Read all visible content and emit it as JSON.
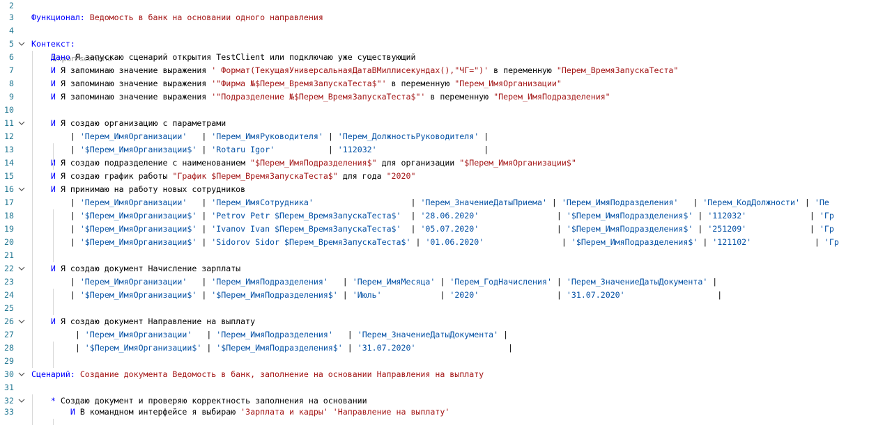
{
  "codelens": "Export scenario",
  "lines": [
    {
      "n": "2",
      "fold": false,
      "segs": []
    },
    {
      "n": "3",
      "fold": false,
      "segs": [
        {
          "c": "kw",
          "t": "Функционал: "
        },
        {
          "c": "s",
          "t": "Ведомость в банк на основании одного направления"
        }
      ]
    },
    {
      "n": "4",
      "fold": false,
      "segs": []
    },
    {
      "n": "5",
      "fold": true,
      "segs": [
        {
          "c": "kw",
          "t": "Контекст:"
        }
      ]
    },
    {
      "n": "6",
      "fold": false,
      "segs": [
        {
          "c": "t",
          "t": "    "
        },
        {
          "c": "kw",
          "t": "Дано "
        },
        {
          "c": "t",
          "t": "Я запускаю сценарий открытия TestClient или подключаю уже существующий"
        }
      ]
    },
    {
      "n": "7",
      "fold": false,
      "segs": [
        {
          "c": "t",
          "t": "    "
        },
        {
          "c": "kw",
          "t": "И "
        },
        {
          "c": "t",
          "t": "Я запоминаю значение выражения "
        },
        {
          "c": "s",
          "t": "' Формат(ТекущаяУниверсальнаяДатаВМиллисекундах(),\"ЧГ=\")'"
        },
        {
          "c": "t",
          "t": " в переменную "
        },
        {
          "c": "s",
          "t": "\"Перем_ВремяЗапускаТеста\""
        }
      ]
    },
    {
      "n": "8",
      "fold": false,
      "segs": [
        {
          "c": "t",
          "t": "    "
        },
        {
          "c": "kw",
          "t": "И "
        },
        {
          "c": "t",
          "t": "Я запоминаю значение выражения "
        },
        {
          "c": "s",
          "t": "'\"Фирма №$Перем_ВремяЗапускаТеста$\"'"
        },
        {
          "c": "t",
          "t": " в переменную "
        },
        {
          "c": "s",
          "t": "\"Перем_ИмяОрганизации\""
        }
      ]
    },
    {
      "n": "9",
      "fold": false,
      "segs": [
        {
          "c": "t",
          "t": "    "
        },
        {
          "c": "kw",
          "t": "И "
        },
        {
          "c": "t",
          "t": "Я запоминаю значение выражения "
        },
        {
          "c": "s",
          "t": "'\"Подразделение №$Перем_ВремяЗапускаТеста$\"'"
        },
        {
          "c": "t",
          "t": " в переменную "
        },
        {
          "c": "s",
          "t": "\"Перем_ИмяПодразделения\""
        }
      ]
    },
    {
      "n": "10",
      "fold": false,
      "segs": []
    },
    {
      "n": "11",
      "fold": true,
      "segs": [
        {
          "c": "t",
          "t": "    "
        },
        {
          "c": "kw",
          "t": "И "
        },
        {
          "c": "t",
          "t": "Я создаю организацию с параметрами"
        }
      ]
    },
    {
      "n": "12",
      "fold": false,
      "segs": [
        {
          "c": "t",
          "t": "        "
        },
        {
          "c": "p",
          "t": "| "
        },
        {
          "c": "tb",
          "t": "'Перем_ИмяОрганизации'   "
        },
        {
          "c": "p",
          "t": "| "
        },
        {
          "c": "tb",
          "t": "'Перем_ИмяРуководителя' "
        },
        {
          "c": "p",
          "t": "| "
        },
        {
          "c": "tb",
          "t": "'Перем_ДолжностьРуководителя' "
        },
        {
          "c": "p",
          "t": "|"
        }
      ]
    },
    {
      "n": "13",
      "fold": false,
      "segs": [
        {
          "c": "t",
          "t": "        "
        },
        {
          "c": "p",
          "t": "| "
        },
        {
          "c": "tb",
          "t": "'$Перем_ИмяОрганизации$' "
        },
        {
          "c": "p",
          "t": "| "
        },
        {
          "c": "tb",
          "t": "'Rotaru Igor'           "
        },
        {
          "c": "p",
          "t": "| "
        },
        {
          "c": "tb",
          "t": "'112032'                      "
        },
        {
          "c": "p",
          "t": "|"
        }
      ]
    },
    {
      "n": "14",
      "fold": false,
      "segs": [
        {
          "c": "t",
          "t": "    "
        },
        {
          "c": "kw",
          "t": "И "
        },
        {
          "c": "t",
          "t": "Я создаю подразделение с наименованием "
        },
        {
          "c": "s",
          "t": "\"$Перем_ИмяПодразделения$\""
        },
        {
          "c": "t",
          "t": " для организации "
        },
        {
          "c": "s",
          "t": "\"$Перем_ИмяОрганизации$\""
        }
      ]
    },
    {
      "n": "15",
      "fold": false,
      "segs": [
        {
          "c": "t",
          "t": "    "
        },
        {
          "c": "kw",
          "t": "И "
        },
        {
          "c": "t",
          "t": "Я создаю график работы "
        },
        {
          "c": "s",
          "t": "\"График $Перем_ВремяЗапускаТеста$\""
        },
        {
          "c": "t",
          "t": " для года "
        },
        {
          "c": "s",
          "t": "\"2020\""
        }
      ]
    },
    {
      "n": "16",
      "fold": true,
      "segs": [
        {
          "c": "t",
          "t": "    "
        },
        {
          "c": "kw",
          "t": "И "
        },
        {
          "c": "t",
          "t": "Я принимаю на работу новых сотрудников"
        }
      ]
    },
    {
      "n": "17",
      "fold": false,
      "segs": [
        {
          "c": "t",
          "t": "        "
        },
        {
          "c": "p",
          "t": "| "
        },
        {
          "c": "tb",
          "t": "'Перем_ИмяОрганизации'   "
        },
        {
          "c": "p",
          "t": "| "
        },
        {
          "c": "tb",
          "t": "'Перем_ИмяСотрудника'                    "
        },
        {
          "c": "p",
          "t": "| "
        },
        {
          "c": "tb",
          "t": "'Перем_ЗначениеДатыПриема' "
        },
        {
          "c": "p",
          "t": "| "
        },
        {
          "c": "tb",
          "t": "'Перем_ИмяПодразделения'   "
        },
        {
          "c": "p",
          "t": "| "
        },
        {
          "c": "tb",
          "t": "'Перем_КодДолжности' "
        },
        {
          "c": "p",
          "t": "| "
        },
        {
          "c": "tb",
          "t": "'Пе"
        }
      ]
    },
    {
      "n": "18",
      "fold": false,
      "segs": [
        {
          "c": "t",
          "t": "        "
        },
        {
          "c": "p",
          "t": "| "
        },
        {
          "c": "tb",
          "t": "'$Перем_ИмяОрганизации$' "
        },
        {
          "c": "p",
          "t": "| "
        },
        {
          "c": "tb",
          "t": "'Petrov Petr $Перем_ВремяЗапускаТеста$'  "
        },
        {
          "c": "p",
          "t": "| "
        },
        {
          "c": "tb",
          "t": "'28.06.2020'                "
        },
        {
          "c": "p",
          "t": "| "
        },
        {
          "c": "tb",
          "t": "'$Перем_ИмяПодразделения$' "
        },
        {
          "c": "p",
          "t": "| "
        },
        {
          "c": "tb",
          "t": "'112032'             "
        },
        {
          "c": "p",
          "t": "| "
        },
        {
          "c": "tb",
          "t": "'Гр"
        }
      ]
    },
    {
      "n": "19",
      "fold": false,
      "segs": [
        {
          "c": "t",
          "t": "        "
        },
        {
          "c": "p",
          "t": "| "
        },
        {
          "c": "tb",
          "t": "'$Перем_ИмяОрганизации$' "
        },
        {
          "c": "p",
          "t": "| "
        },
        {
          "c": "tb",
          "t": "'Ivanov Ivan $Перем_ВремяЗапускаТеста$'  "
        },
        {
          "c": "p",
          "t": "| "
        },
        {
          "c": "tb",
          "t": "'05.07.2020'                "
        },
        {
          "c": "p",
          "t": "| "
        },
        {
          "c": "tb",
          "t": "'$Перем_ИмяПодразделения$' "
        },
        {
          "c": "p",
          "t": "| "
        },
        {
          "c": "tb",
          "t": "'251209'             "
        },
        {
          "c": "p",
          "t": "| "
        },
        {
          "c": "tb",
          "t": "'Гр"
        }
      ]
    },
    {
      "n": "20",
      "fold": false,
      "segs": [
        {
          "c": "t",
          "t": "        "
        },
        {
          "c": "p",
          "t": "| "
        },
        {
          "c": "tb",
          "t": "'$Перем_ИмяОрганизации$' "
        },
        {
          "c": "p",
          "t": "| "
        },
        {
          "c": "tb",
          "t": "'Sidorov Sidor $Перем_ВремяЗапускаТеста$' "
        },
        {
          "c": "p",
          "t": "| "
        },
        {
          "c": "tb",
          "t": "'01.06.2020'                "
        },
        {
          "c": "p",
          "t": "| "
        },
        {
          "c": "tb",
          "t": "'$Перем_ИмяПодразделения$' "
        },
        {
          "c": "p",
          "t": "| "
        },
        {
          "c": "tb",
          "t": "'121102'             "
        },
        {
          "c": "p",
          "t": "| "
        },
        {
          "c": "tb",
          "t": "'Гр"
        }
      ]
    },
    {
      "n": "21",
      "fold": false,
      "segs": []
    },
    {
      "n": "22",
      "fold": true,
      "segs": [
        {
          "c": "t",
          "t": "    "
        },
        {
          "c": "kw",
          "t": "И "
        },
        {
          "c": "t",
          "t": "Я создаю документ Начисление зарплаты"
        }
      ]
    },
    {
      "n": "23",
      "fold": false,
      "segs": [
        {
          "c": "t",
          "t": "        "
        },
        {
          "c": "p",
          "t": "| "
        },
        {
          "c": "tb",
          "t": "'Перем_ИмяОрганизации'   "
        },
        {
          "c": "p",
          "t": "| "
        },
        {
          "c": "tb",
          "t": "'Перем_ИмяПодразделения'   "
        },
        {
          "c": "p",
          "t": "| "
        },
        {
          "c": "tb",
          "t": "'Перем_ИмяМесяца' "
        },
        {
          "c": "p",
          "t": "| "
        },
        {
          "c": "tb",
          "t": "'Перем_ГодНачисления' "
        },
        {
          "c": "p",
          "t": "| "
        },
        {
          "c": "tb",
          "t": "'Перем_ЗначениеДатыДокумента' "
        },
        {
          "c": "p",
          "t": "|"
        }
      ]
    },
    {
      "n": "24",
      "fold": false,
      "segs": [
        {
          "c": "t",
          "t": "        "
        },
        {
          "c": "p",
          "t": "| "
        },
        {
          "c": "tb",
          "t": "'$Перем_ИмяОрганизации$' "
        },
        {
          "c": "p",
          "t": "| "
        },
        {
          "c": "tb",
          "t": "'$Перем_ИмяПодразделения$' "
        },
        {
          "c": "p",
          "t": "| "
        },
        {
          "c": "tb",
          "t": "'Июль'            "
        },
        {
          "c": "p",
          "t": "| "
        },
        {
          "c": "tb",
          "t": "'2020'                "
        },
        {
          "c": "p",
          "t": "| "
        },
        {
          "c": "tb",
          "t": "'31.07.2020'                   "
        },
        {
          "c": "p",
          "t": "|"
        }
      ]
    },
    {
      "n": "25",
      "fold": false,
      "segs": []
    },
    {
      "n": "26",
      "fold": true,
      "segs": [
        {
          "c": "t",
          "t": "    "
        },
        {
          "c": "kw",
          "t": "И "
        },
        {
          "c": "t",
          "t": "Я создаю документ Направление на выплату"
        }
      ]
    },
    {
      "n": "27",
      "fold": false,
      "segs": [
        {
          "c": "t",
          "t": "         "
        },
        {
          "c": "p",
          "t": "| "
        },
        {
          "c": "tb",
          "t": "'Перем_ИмяОрганизации'   "
        },
        {
          "c": "p",
          "t": "| "
        },
        {
          "c": "tb",
          "t": "'Перем_ИмяПодразделения'   "
        },
        {
          "c": "p",
          "t": "| "
        },
        {
          "c": "tb",
          "t": "'Перем_ЗначениеДатыДокумента' "
        },
        {
          "c": "p",
          "t": "|"
        }
      ]
    },
    {
      "n": "28",
      "fold": false,
      "segs": [
        {
          "c": "t",
          "t": "         "
        },
        {
          "c": "p",
          "t": "| "
        },
        {
          "c": "tb",
          "t": "'$Перем_ИмяОрганизации$' "
        },
        {
          "c": "p",
          "t": "| "
        },
        {
          "c": "tb",
          "t": "'$Перем_ИмяПодразделения$' "
        },
        {
          "c": "p",
          "t": "| "
        },
        {
          "c": "tb",
          "t": "'31.07.2020'                   "
        },
        {
          "c": "p",
          "t": "|"
        }
      ]
    },
    {
      "n": "29",
      "fold": false,
      "segs": []
    },
    {
      "n": "30",
      "fold": true,
      "segs": [
        {
          "c": "kw",
          "t": "Сценарий: "
        },
        {
          "c": "s",
          "t": "Создание документа Ведомость в банк, заполнение на основании Направления на выплату"
        }
      ]
    },
    {
      "n": "31",
      "fold": false,
      "segs": []
    },
    {
      "n": "32",
      "fold": true,
      "segs": [
        {
          "c": "t",
          "t": "    "
        },
        {
          "c": "kw",
          "t": "* "
        },
        {
          "c": "t",
          "t": "Создаю документ и проверяю корректность заполнения на основании"
        }
      ]
    },
    {
      "n": "33",
      "fold": false,
      "segs": [
        {
          "c": "t",
          "t": "        "
        },
        {
          "c": "kw",
          "t": "И "
        },
        {
          "c": "t",
          "t": "В командном интерфейсе я выбираю "
        },
        {
          "c": "s",
          "t": "'Зарплата и кадры'"
        },
        {
          "c": "t",
          "t": " "
        },
        {
          "c": "s",
          "t": "'Направление на выплату'"
        }
      ]
    }
  ]
}
